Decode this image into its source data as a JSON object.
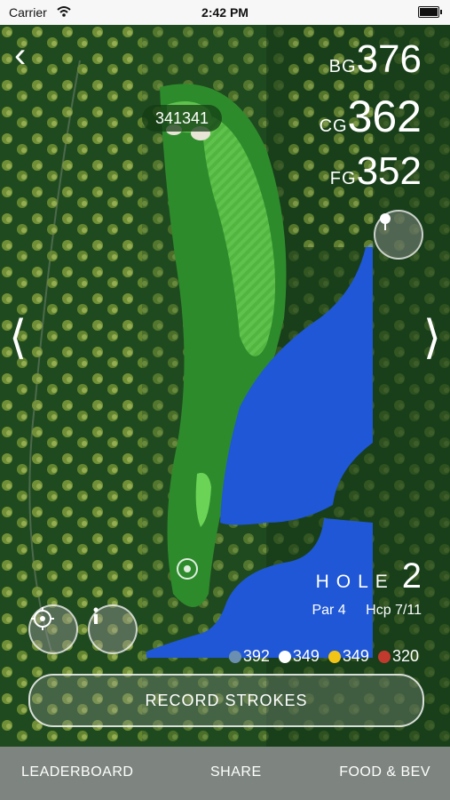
{
  "status_bar": {
    "carrier": "Carrier",
    "time": "2:42 PM"
  },
  "distances": {
    "back": {
      "label": "BG",
      "value": "376"
    },
    "center": {
      "label": "CG",
      "value": "362"
    },
    "front": {
      "label": "FG",
      "value": "352"
    }
  },
  "pin_marker": {
    "text": "341341"
  },
  "hole": {
    "word": "HOLE",
    "number": "2",
    "par": "Par 4",
    "handicap": "Hcp 7/11"
  },
  "tees": [
    {
      "color": "#6b8fb0",
      "yards": "392"
    },
    {
      "color": "#ffffff",
      "yards": "349"
    },
    {
      "color": "#f2c418",
      "yards": "349"
    },
    {
      "color": "#c23a2e",
      "yards": "320"
    }
  ],
  "record_button": {
    "label": "RECORD STROKES"
  },
  "tabs": [
    {
      "label": "LEADERBOARD"
    },
    {
      "label": "SHARE"
    },
    {
      "label": "FOOD & BEV"
    }
  ],
  "icons": {
    "back": "chevron-left-icon",
    "prev": "chevron-left-icon",
    "next": "chevron-right-icon",
    "pin": "flag-pin-icon",
    "target": "crosshair-icon",
    "info": "info-icon"
  },
  "colors": {
    "rough": "#1f4a1f",
    "fairway": "#3da83a",
    "water": "#1f57d6",
    "tabbar": "#7e8580"
  }
}
